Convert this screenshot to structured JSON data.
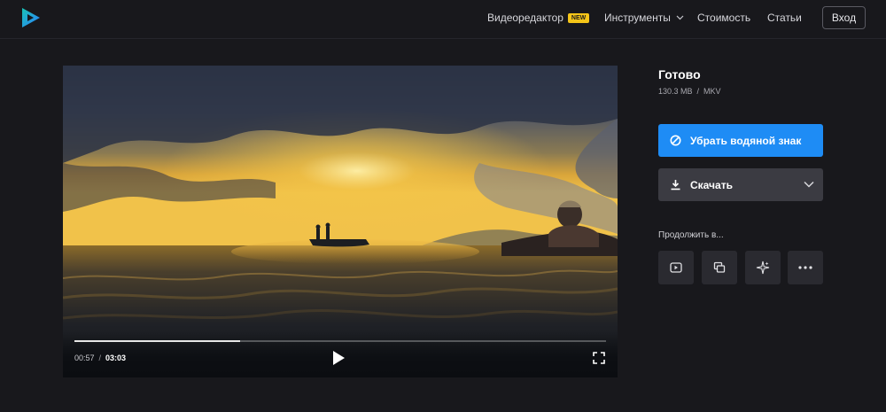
{
  "header": {
    "logo_icon": "play-logo-icon",
    "nav": [
      {
        "label": "Видеоредактор",
        "badge": "NEW"
      },
      {
        "label": "Инструменты",
        "has_dropdown": true
      },
      {
        "label": "Стоимость"
      },
      {
        "label": "Статьи"
      }
    ],
    "login_label": "Вход"
  },
  "player": {
    "current_time": "00:57",
    "separator": "/",
    "total_time": "03:03",
    "progress_fraction": 0.311,
    "icons": {
      "play": "play-icon",
      "fullscreen": "fullscreen-icon"
    }
  },
  "file": {
    "title": "Готово",
    "size": "130.3 MB",
    "separator": "/",
    "format": "MKV"
  },
  "actions": {
    "remove_watermark_label": "Убрать водяной знак",
    "download_label": "Скачать",
    "continue_label": "Продолжить в..."
  },
  "tools": [
    "video-player-icon",
    "layers-icon",
    "sparkle-icon",
    "more-icon"
  ],
  "colors": {
    "background": "#18181c",
    "accent_blue": "#1e8cf5",
    "badge_yellow": "#f5c518",
    "logo_teal": "#19c3b4",
    "logo_blue": "#2c7fff"
  }
}
